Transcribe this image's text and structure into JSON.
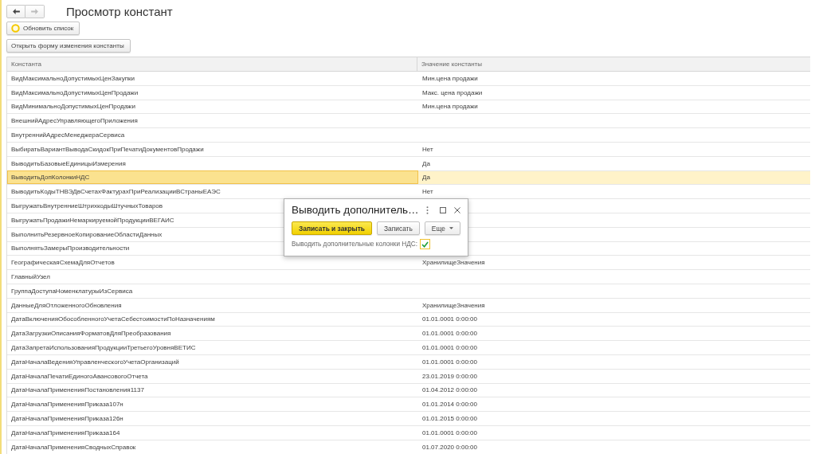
{
  "nav_buttons": [
    {
      "kind": "back",
      "disabled": false
    },
    {
      "kind": "forward",
      "disabled": true
    }
  ],
  "title": "Просмотр констант",
  "toolbar": [
    {
      "label": "Обновить список",
      "kind": "refresh"
    },
    {
      "label": "Открыть форму изменения константы",
      "kind": "plain"
    }
  ],
  "table": {
    "columns": [
      "Константа",
      "Значение константы"
    ],
    "rows": [
      {
        "name": "ВидМаксимальноДопустимыхЦенЗакупки",
        "value": "Мин.цена продажи",
        "selected": false
      },
      {
        "name": "ВидМаксимальноДопустимыхЦенПродажи",
        "value": "Макс. цена продажи",
        "selected": false
      },
      {
        "name": "ВидМинимальноДопустимыхЦенПродажи",
        "value": "Мин.цена продажи",
        "selected": false
      },
      {
        "name": "ВнешнийАдресУправляющегоПриложения",
        "selected": false
      },
      {
        "name": "ВнутреннийАдресМенеджераСервиса",
        "selected": false
      },
      {
        "name": "ВыбиратьВариантВыводаСкидокПриПечатиДокументовПродажи",
        "value": "Нет",
        "selected": false
      },
      {
        "name": "ВыводитьБазовыеЕдиницыИзмерения",
        "value": "Да",
        "selected": false
      },
      {
        "name": "ВыводитьДопКолонкиНДС",
        "value": "Да",
        "selected": true
      },
      {
        "name": "ВыводитьКодыТНВЭДвСчетахФактурахПриРеализацииВСтраныЕАЭС",
        "value": "Нет",
        "selected": false
      },
      {
        "name": "ВыгружатьВнутренниеШтрихкодыШтучныхТоваров",
        "selected": false
      },
      {
        "name": "ВыгружатьПродажиНемаркируемойПродукцииВЕГАИС",
        "selected": false
      },
      {
        "name": "ВыполнитьРезервноеКопированиеОбластиДанных",
        "selected": false
      },
      {
        "name": "ВыполнятьЗамерыПроизводительности",
        "selected": false
      },
      {
        "name": "ГеографическаяСхемаДляОтчетов",
        "value": "ХранилищеЗначения",
        "selected": false
      },
      {
        "name": "ГлавныйУзел",
        "selected": false
      },
      {
        "name": "ГруппаДоступаНоменклатурыИзСервиса",
        "selected": false
      },
      {
        "name": "ДанныеДляОтложенногоОбновления",
        "value": "ХранилищеЗначения",
        "selected": false
      },
      {
        "name": "ДатаВключенияОбособленногоУчетаСебестоимостиПоНазначениям",
        "value": "01.01.0001 0:00:00",
        "selected": false
      },
      {
        "name": "ДатаЗагрузкиОписанияФорматовДляПреобразования",
        "value": "01.01.0001 0:00:00",
        "selected": false
      },
      {
        "name": "ДатаЗапретаИспользованияПродукцииТретьегоУровняВЕТИС",
        "value": "01.01.0001 0:00:00",
        "selected": false
      },
      {
        "name": "ДатаНачалаВеденияУправленческогоУчетаОрганизаций",
        "value": "01.01.0001 0:00:00",
        "selected": false
      },
      {
        "name": "ДатаНачалаПечатиЕдиногоАвансовогоОтчета",
        "value": "23.01.2019 0:00:00",
        "selected": false
      },
      {
        "name": "ДатаНачалаПримененияПостановления1137",
        "value": "01.04.2012 0:00:00",
        "selected": false
      },
      {
        "name": "ДатаНачалаПримененияПриказа107н",
        "value": "01.01.2014 0:00:00",
        "selected": false
      },
      {
        "name": "ДатаНачалаПримененияПриказа126н",
        "value": "01.01.2015 0:00:00",
        "selected": false
      },
      {
        "name": "ДатаНачалаПримененияПриказа164",
        "value": "01.01.0001 0:00:00",
        "selected": false
      },
      {
        "name": "ДатаНачалаПримененияСводныхСправок",
        "value": "01.07.2020 0:00:00",
        "selected": false
      }
    ]
  },
  "dialog": {
    "title": "Выводить дополнитель…",
    "buttons": [
      {
        "label": "Записать и закрыть",
        "kind": "primary"
      },
      {
        "label": "Записать",
        "kind": "default"
      },
      {
        "label": "Еще",
        "kind": "menu"
      }
    ],
    "field": {
      "label": "Выводить дополнительные колонки НДС:",
      "checked": true
    }
  }
}
